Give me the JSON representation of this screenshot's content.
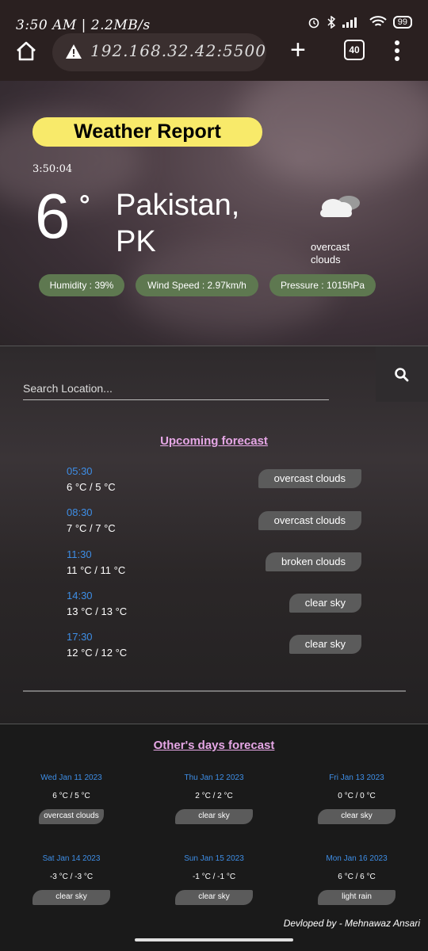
{
  "status_bar": {
    "left": "3:50 AM | 2.2MB/s",
    "battery": "99"
  },
  "browser": {
    "url": "192.168.32.42:5500",
    "tab_count": "40"
  },
  "hero": {
    "title": "Weather Report",
    "clock": "3:50:04",
    "temperature": "6",
    "degree": "°",
    "location": "Pakistan, PK",
    "condition": "overcast clouds",
    "humidity": "Humidity : 39%",
    "wind": "Wind Speed : 2.97km/h",
    "pressure": "Pressure : 1015hPa"
  },
  "search": {
    "placeholder": "Search Location..."
  },
  "upcoming": {
    "title": "Upcoming forecast",
    "items": [
      {
        "time": "05:30",
        "temp": "6 °C / 5 °C",
        "condition": "overcast clouds"
      },
      {
        "time": "08:30",
        "temp": "7 °C / 7 °C",
        "condition": "overcast clouds"
      },
      {
        "time": "11:30",
        "temp": "11 °C / 11 °C",
        "condition": "broken clouds"
      },
      {
        "time": "14:30",
        "temp": "13 °C / 13 °C",
        "condition": "clear sky"
      },
      {
        "time": "17:30",
        "temp": "12 °C / 12 °C",
        "condition": "clear sky"
      }
    ]
  },
  "days": {
    "title": "Other's days forecast",
    "items": [
      {
        "date": "Wed Jan 11 2023",
        "temp": "6 °C / 5 °C",
        "condition": "overcast clouds"
      },
      {
        "date": "Thu Jan 12 2023",
        "temp": "2 °C / 2 °C",
        "condition": "clear sky"
      },
      {
        "date": "Fri Jan 13 2023",
        "temp": "0 °C / 0 °C",
        "condition": "clear sky"
      },
      {
        "date": "Sat Jan 14 2023",
        "temp": "-3 °C / -3 °C",
        "condition": "clear sky"
      },
      {
        "date": "Sun Jan 15 2023",
        "temp": "-1 °C / -1 °C",
        "condition": "clear sky"
      },
      {
        "date": "Mon Jan 16 2023",
        "temp": "6 °C / 6 °C",
        "condition": "light rain"
      }
    ]
  },
  "credit": "Devloped by - Mehnawaz Ansari"
}
